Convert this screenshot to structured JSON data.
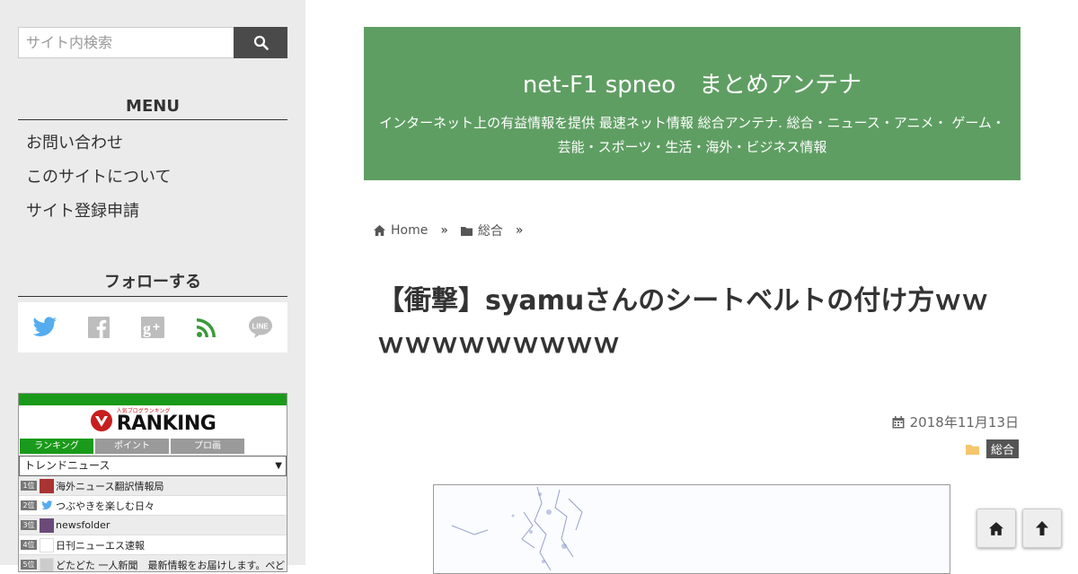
{
  "search": {
    "placeholder": "サイト内検索"
  },
  "menu": {
    "title": "MENU",
    "items": [
      "お問い合わせ",
      "このサイトについて",
      "サイト登録申請"
    ]
  },
  "follow": {
    "title": "フォローする",
    "icons": [
      "twitter-icon",
      "facebook-icon",
      "google-plus-icon",
      "rss-icon",
      "line-icon"
    ],
    "colors": {
      "twitter": "#55acee",
      "rss": "#3a9a3a",
      "muted": "#bdbdbd"
    }
  },
  "ranking": {
    "logo_small": "人気ブログランキング",
    "logo_text": "RANKING",
    "tabs": [
      "ランキング",
      "ポイント",
      "プロ画"
    ],
    "select": "トレンドニュース",
    "rows": [
      {
        "rank": "1位",
        "name": "海外ニュース翻訳情報局"
      },
      {
        "rank": "2位",
        "name": "つぶやきを楽しむ日々"
      },
      {
        "rank": "3位",
        "name": "newsfolder"
      },
      {
        "rank": "4位",
        "name": "日刊ニューエス速報"
      },
      {
        "rank": "5位",
        "name": "どたどた 一人新聞　最新情報をお届けします。ぺど"
      }
    ]
  },
  "header": {
    "title": "net-F1 spneo　まとめアンテナ",
    "description": "インターネット上の有益情報を提供 最速ネット情報 総合アンテナ. 総合・ニュース・アニメ・ ゲーム・芸能・スポーツ・生活・海外・ビジネス情報",
    "bg_color": "#5f9e63"
  },
  "breadcrumb": {
    "home": "Home",
    "category": "総合",
    "sep": "»"
  },
  "article": {
    "title": "【衝撃】syamuさんのシートベルトの付け方ｗｗｗｗｗｗｗｗｗｗｗ",
    "date": "2018年11月13日",
    "category": "総合"
  }
}
